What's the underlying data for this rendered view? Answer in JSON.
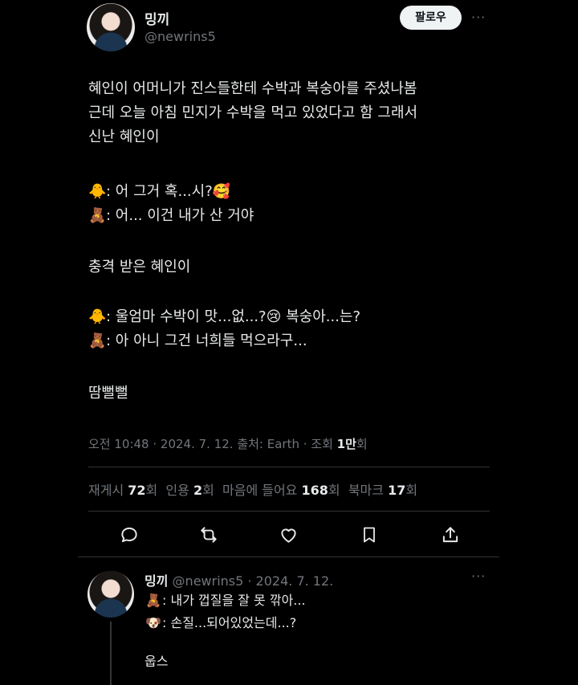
{
  "tweet": {
    "display_name": "밍끼",
    "handle": "@newrins5",
    "follow_label": "팔로우",
    "more_label": "···",
    "body": {
      "p1": [
        "혜인이 어머니가 진스들한테 수박과 복숭아를 주셨나봄",
        "근데 오늘 아침 민지가 수박을 먹고 있었다고 함 그래서",
        "신난 혜인이"
      ],
      "dialog1": [
        {
          "emoji": "🐥",
          "text": ": 어 그거 혹...시?🥰"
        },
        {
          "emoji": "🧸",
          "text": ": 어... 이건 내가 산 거야"
        }
      ],
      "p2": "충격 받은 혜인이",
      "dialog2": [
        {
          "emoji": "🐥",
          "text": ": 울엄마 수박이 맛...없...?😢 복숭아...는?"
        },
        {
          "emoji": "🧸",
          "text": ": 아 아니 그건 너희들 먹으라구..."
        }
      ],
      "p3": "땀뻘뻘"
    },
    "meta": {
      "time": "오전 10:48 · 2024. 7. 12. 출처: Earth · 조회 ",
      "views_num": "1만",
      "views_unit": "회"
    },
    "stats": [
      {
        "label": "재게시 ",
        "num": "72",
        "unit": "회"
      },
      {
        "label": "인용 ",
        "num": "2",
        "unit": "회"
      },
      {
        "label": "마음에 들어요 ",
        "num": "168",
        "unit": "회"
      },
      {
        "label": "북마크 ",
        "num": "17",
        "unit": "회"
      }
    ],
    "actions": [
      "reply-icon",
      "retweet-icon",
      "like-icon",
      "bookmark-icon",
      "share-icon"
    ]
  },
  "reply": {
    "display_name": "밍끼",
    "handle_date": "@newrins5 · 2024. 7. 12.",
    "more_label": "···",
    "lines": [
      {
        "emoji": "🧸",
        "text": ": 내가 껍질을 잘 못 깎아..."
      },
      {
        "emoji": "🐶",
        "text": ": 손질...되어있었는데...?"
      }
    ],
    "tail": "웁스"
  },
  "colors": {
    "background": "#000000",
    "text": "#e7e9ea",
    "muted": "#71767b",
    "divider": "#2f3336",
    "button_bg": "#eff3f4"
  }
}
